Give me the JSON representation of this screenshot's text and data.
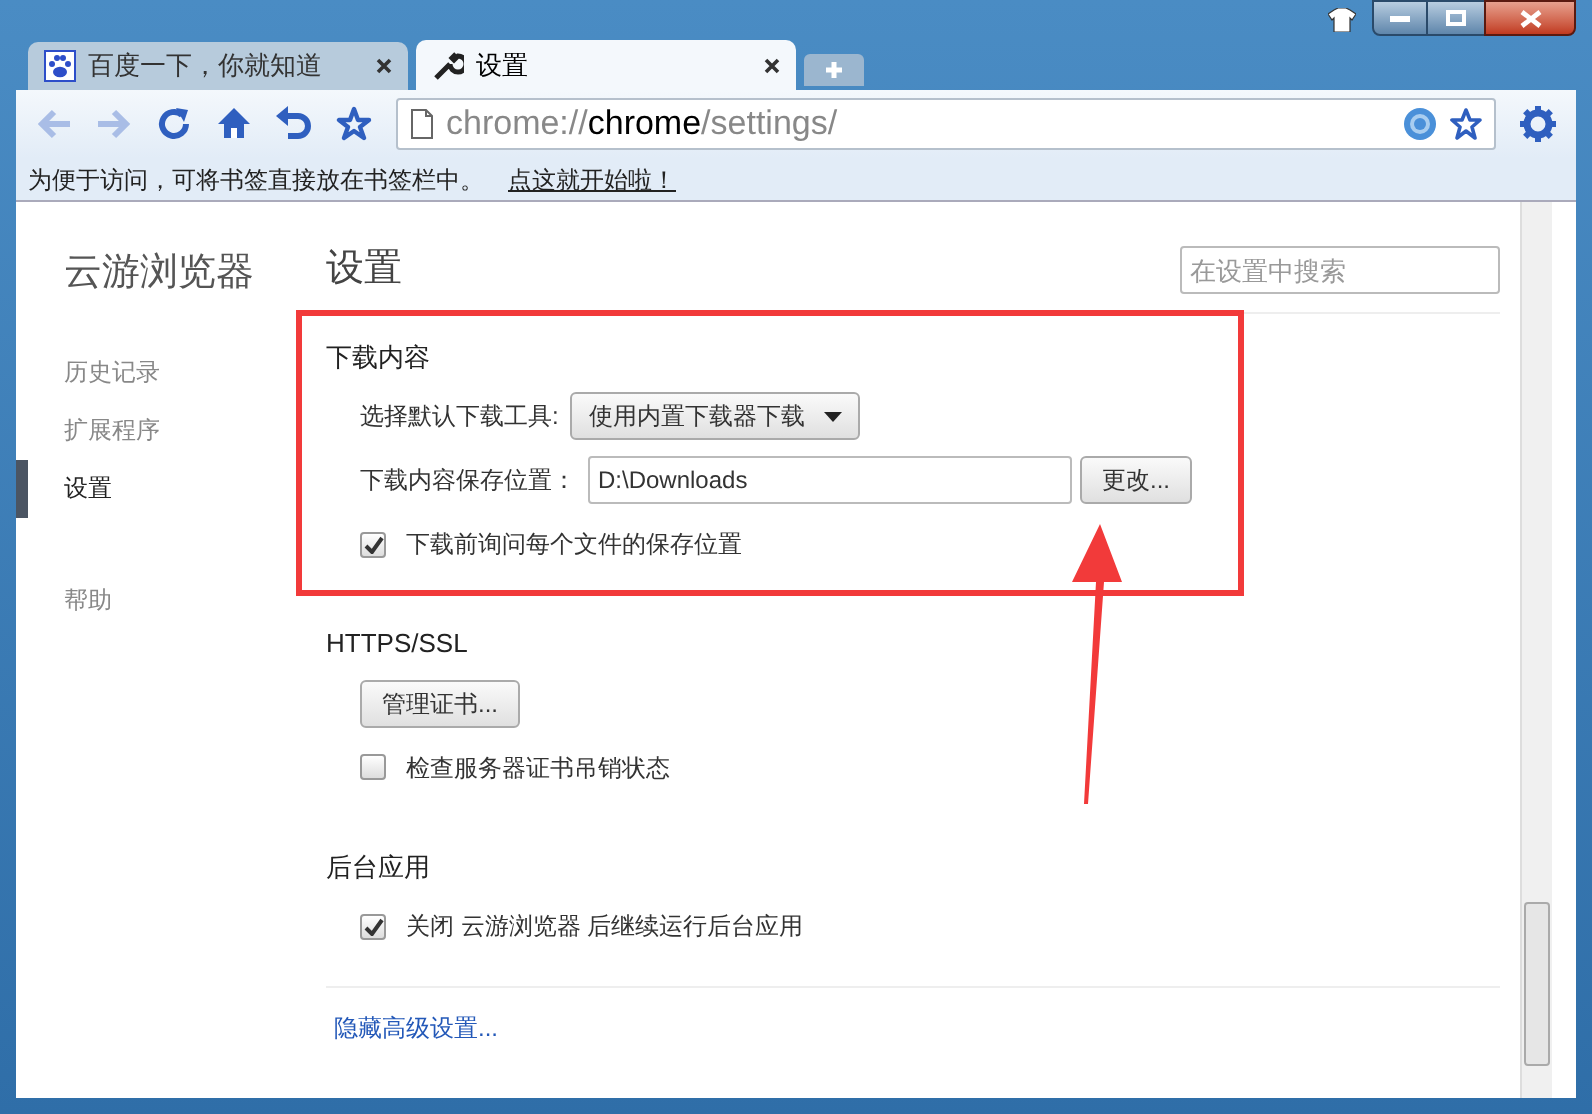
{
  "tabs": [
    {
      "label": "百度一下，你就知道",
      "selected": false
    },
    {
      "label": "设置",
      "selected": true
    }
  ],
  "address": {
    "scheme": "chrome://",
    "host": "chrome",
    "path": "/settings/"
  },
  "bookmark_bar": {
    "message": "为便于访问，可将书签直接放在书签栏中。",
    "link": "点这就开始啦！"
  },
  "sidebar": {
    "title": "云游浏览器",
    "items": [
      {
        "label": "历史记录",
        "selected": false
      },
      {
        "label": "扩展程序",
        "selected": false
      },
      {
        "label": "设置",
        "selected": true
      },
      {
        "label": "帮助",
        "selected": false
      }
    ]
  },
  "page_title": "设置",
  "search": {
    "placeholder": "在设置中搜索"
  },
  "sections": [
    {
      "title": "下载内容",
      "rows": [
        {
          "kind": "select",
          "label": "选择默认下载工具:",
          "value": "使用内置下载器下载"
        },
        {
          "kind": "path",
          "label": "下载内容保存位置：",
          "value": "D:\\Downloads",
          "button": "更改..."
        },
        {
          "kind": "checkbox",
          "label": "下载前询问每个文件的保存位置",
          "checked": true
        }
      ]
    },
    {
      "title": "HTTPS/SSL",
      "rows": [
        {
          "kind": "button",
          "label": "管理证书..."
        },
        {
          "kind": "checkbox",
          "label": "检查服务器证书吊销状态",
          "checked": false
        }
      ]
    },
    {
      "title": "后台应用",
      "rows": [
        {
          "kind": "checkbox",
          "label": "关闭 云游浏览器 后继续运行后台应用",
          "checked": true
        }
      ]
    }
  ],
  "footer_link": "隐藏高级设置..."
}
